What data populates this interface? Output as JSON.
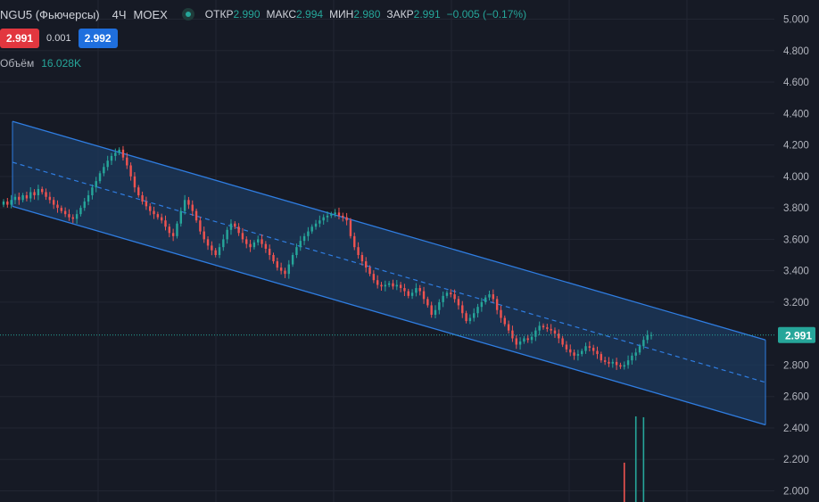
{
  "header": {
    "symbol": "NGU5 (Фьючерсы)",
    "timeframe": "4Ч",
    "exchange": "MOEX",
    "open_label": "ОТКР",
    "open_value": "2.990",
    "high_label": "МАКС",
    "high_value": "2.994",
    "low_label": "МИН",
    "low_value": "2.980",
    "close_label": "ЗАКР",
    "close_value": "2.991",
    "change": "−0.005 (−0.17%)"
  },
  "trade": {
    "sell_price": "2.991",
    "spread": "0.001",
    "buy_price": "2.992"
  },
  "volume": {
    "label": "Объём",
    "value": "16.028K"
  },
  "colors": {
    "up": "#26a69a",
    "down": "#ef5350",
    "channel": "#2f7de1",
    "channel_fill": "#1c3a5e",
    "background": "#161a25"
  },
  "chart_data": {
    "type": "candlestick",
    "ylim": [
      2.0,
      5.0
    ],
    "y_ticks": [
      "5.000",
      "4.800",
      "4.600",
      "4.400",
      "4.200",
      "4.000",
      "3.800",
      "3.600",
      "3.400",
      "3.200",
      "2.800",
      "2.600",
      "2.400",
      "2.200",
      "2.000"
    ],
    "last_price": 2.991,
    "last_price_label": "2.991",
    "channel": {
      "upper": [
        4.35,
        2.96
      ],
      "middle": [
        4.09,
        2.69
      ],
      "lower": [
        3.81,
        2.42
      ]
    },
    "closes": [
      3.84,
      3.82,
      3.85,
      3.87,
      3.85,
      3.88,
      3.86,
      3.9,
      3.88,
      3.92,
      3.9,
      3.87,
      3.85,
      3.82,
      3.8,
      3.78,
      3.76,
      3.74,
      3.73,
      3.76,
      3.8,
      3.84,
      3.88,
      3.93,
      3.97,
      4.02,
      4.06,
      4.1,
      4.13,
      4.15,
      4.17,
      4.12,
      4.07,
      4.0,
      3.93,
      3.88,
      3.84,
      3.81,
      3.78,
      3.76,
      3.74,
      3.72,
      3.68,
      3.64,
      3.62,
      3.7,
      3.78,
      3.85,
      3.82,
      3.78,
      3.72,
      3.65,
      3.6,
      3.56,
      3.53,
      3.5,
      3.55,
      3.6,
      3.66,
      3.7,
      3.68,
      3.64,
      3.6,
      3.57,
      3.55,
      3.58,
      3.6,
      3.57,
      3.54,
      3.5,
      3.46,
      3.42,
      3.4,
      3.38,
      3.44,
      3.5,
      3.55,
      3.59,
      3.62,
      3.65,
      3.68,
      3.7,
      3.72,
      3.74,
      3.75,
      3.76,
      3.77,
      3.75,
      3.74,
      3.72,
      3.62,
      3.55,
      3.5,
      3.46,
      3.42,
      3.38,
      3.34,
      3.31,
      3.3,
      3.31,
      3.32,
      3.3,
      3.31,
      3.29,
      3.27,
      3.24,
      3.26,
      3.29,
      3.27,
      3.22,
      3.18,
      3.12,
      3.15,
      3.2,
      3.24,
      3.26,
      3.25,
      3.22,
      3.18,
      3.13,
      3.08,
      3.1,
      3.13,
      3.17,
      3.2,
      3.23,
      3.25,
      3.22,
      3.15,
      3.1,
      3.06,
      3.02,
      2.97,
      2.93,
      2.95,
      2.97,
      2.96,
      2.98,
      3.02,
      3.05,
      3.04,
      3.03,
      3.02,
      3.0,
      2.97,
      2.93,
      2.9,
      2.88,
      2.86,
      2.87,
      2.89,
      2.92,
      2.91,
      2.89,
      2.87,
      2.83,
      2.82,
      2.81,
      2.82,
      2.8,
      2.79,
      2.8,
      2.83,
      2.86,
      2.88,
      2.92,
      2.96,
      2.99,
      2.991
    ],
    "volume_spikes": [
      {
        "bar": 161,
        "volume": 0.45
      },
      {
        "bar": 164,
        "volume": 0.98
      },
      {
        "bar": 166,
        "volume": 0.97
      }
    ]
  }
}
